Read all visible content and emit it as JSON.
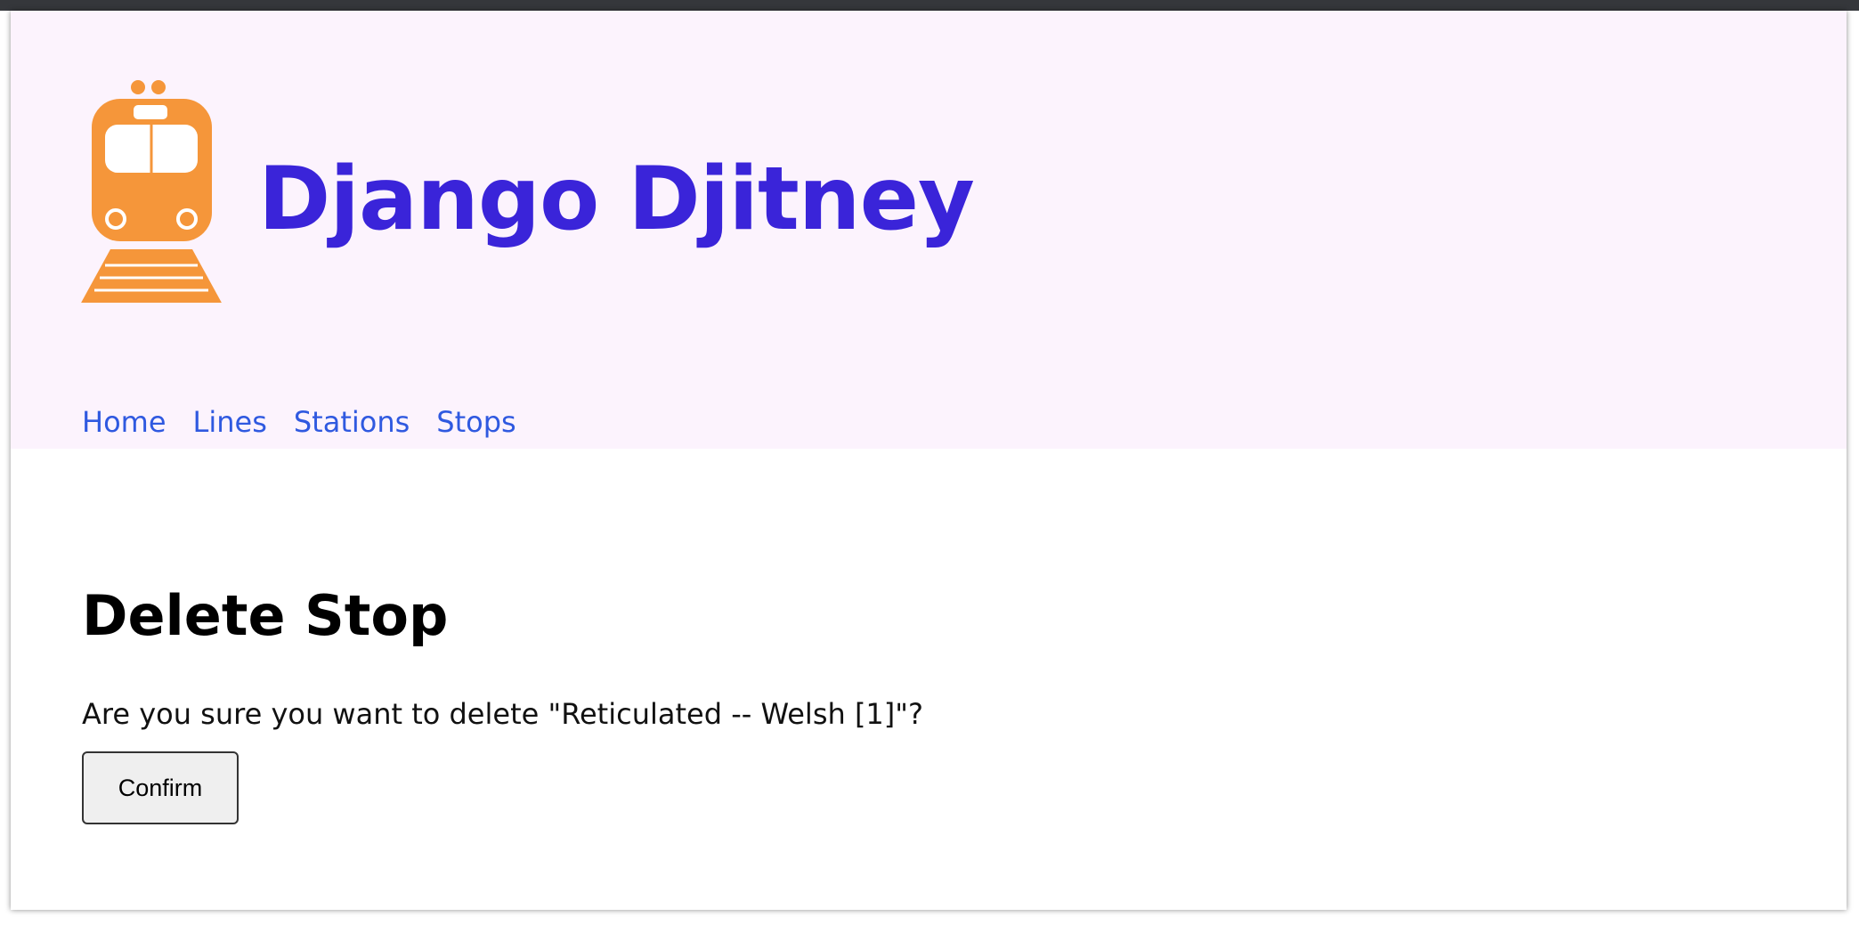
{
  "site": {
    "title": "Django Djitney",
    "logo_icon": "train-icon",
    "logo_color": "#f5963a",
    "title_color": "#3a24d9",
    "header_background": "#fcf3fd"
  },
  "nav": {
    "items": [
      {
        "label": "Home"
      },
      {
        "label": "Lines"
      },
      {
        "label": "Stations"
      },
      {
        "label": "Stops"
      }
    ],
    "link_color": "#2f59e0"
  },
  "main": {
    "heading": "Delete Stop",
    "prompt": "Are you sure you want to delete \"Reticulated -- Welsh [1]\"?",
    "confirm_label": "Confirm"
  }
}
